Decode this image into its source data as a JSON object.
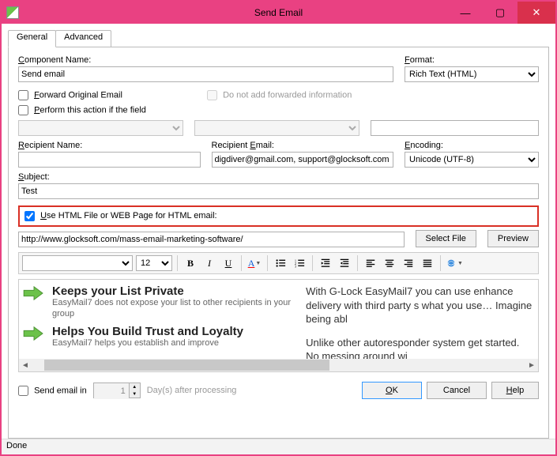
{
  "window": {
    "title": "Send Email"
  },
  "win_buttons": {
    "min": "—",
    "max": "▢",
    "close": "✕"
  },
  "tabs": {
    "general": "General",
    "advanced": "Advanced"
  },
  "labels": {
    "component_name": "Component Name:",
    "format": "Format:",
    "forward_original": "Forward Original Email",
    "do_not_add_fwd": "Do not add forwarded information",
    "perform_if_field": "Perform this action if the field",
    "recipient_name": "Recipient Name:",
    "recipient_email": "Recipient Email:",
    "encoding": "Encoding:",
    "subject": "Subject:",
    "use_html_file": "Use HTML File or WEB Page for HTML email:",
    "select_file": "Select File",
    "preview": "Preview",
    "send_email_in": "Send email in",
    "days_after": "Day(s) after processing",
    "ok": "OK",
    "cancel": "Cancel",
    "help": "Help"
  },
  "values": {
    "component_name": "Send email",
    "format": "Rich Text (HTML)",
    "recipient_email": "digdiver@gmail.com, support@glocksoft.com",
    "encoding": "Unicode (UTF-8)",
    "subject": "Test",
    "html_path": "http://www.glocksoft.com/mass-email-marketing-software/",
    "send_email_in_days": "1",
    "use_html_file_checked": true,
    "forward_checked": false,
    "perform_checked": false,
    "send_in_checked": false
  },
  "toolbar": {
    "font_family": "",
    "font_size": "12"
  },
  "preview": {
    "feat1_title": "Keeps your List Private",
    "feat1_sub": "EasyMail7 does not expose your list to other recipients in your group",
    "feat2_title": "Helps You Build Trust and Loyalty",
    "feat2_sub": "EasyMail7 helps you establish and improve",
    "right_p1": "With G-Lock EasyMail7 you can use enhance delivery with third party s what you use… Imagine being abl",
    "right_p2": "Unlike other autoresponder system get started. No messing around wi"
  },
  "status": "Done"
}
